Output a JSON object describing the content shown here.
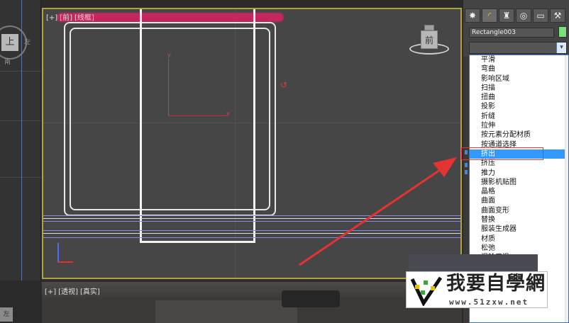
{
  "front_viewport": {
    "label_parts": [
      "[+]",
      "[前]",
      "[线框]"
    ],
    "navcube_face": "前",
    "axis_y": "y",
    "axis_x": "x"
  },
  "left_strip": {
    "cube_face": "上",
    "labels": [
      "左",
      "南"
    ]
  },
  "persp_viewport": {
    "label_parts": [
      "[+]",
      "[透视]",
      "[真实]"
    ]
  },
  "left_bottom_btn": "左",
  "command_panel": {
    "tabs": [
      "create-icon",
      "modify-icon",
      "hierarchy-icon",
      "motion-icon",
      "display-icon",
      "utilities-icon"
    ],
    "object_name": "Rectangle003",
    "color_swatch": "#7be07b",
    "modifier_list": [
      "平滑",
      "弯曲",
      "影响区域",
      "扫描",
      "扭曲",
      "投影",
      "折缝",
      "拉伸",
      "按元素分配材质",
      "按通道选择",
      "挤出",
      "挤压",
      "推力",
      "摄影机贴图",
      "晶格",
      "曲面",
      "曲面变形",
      "替换",
      "服装生成器",
      "材质",
      "松弛",
      "涡轮平滑"
    ],
    "selected_index": 10
  },
  "watermark": {
    "title": "我要自學網",
    "url": "www.51zxw.net"
  },
  "colors": {
    "accent_select": "#3399ff",
    "annotation_red": "#e33333",
    "viewport_border": "#b3a23c",
    "spline_highlight": "#c8245f"
  }
}
